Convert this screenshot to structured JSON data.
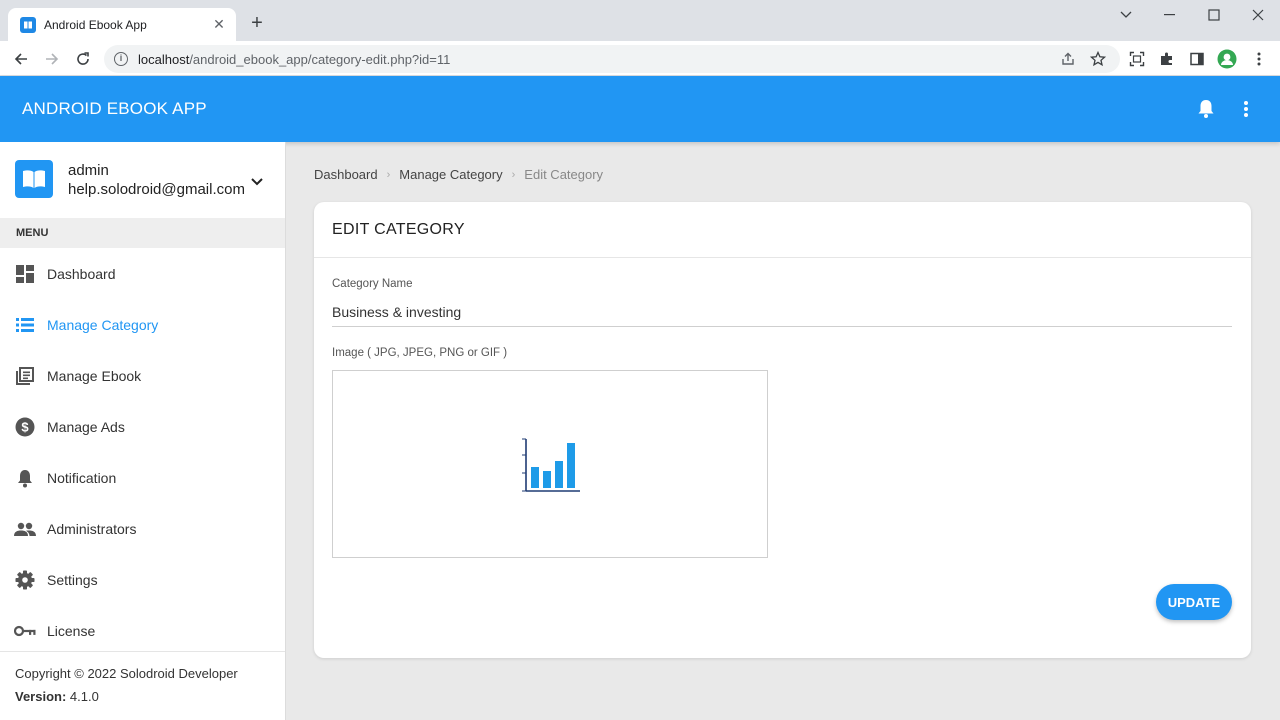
{
  "browser": {
    "tab_title": "Android Ebook App",
    "url_host": "localhost",
    "url_path": "/android_ebook_app/category-edit.php?id=11"
  },
  "app": {
    "title": "ANDROID EBOOK APP",
    "accent_color": "#2196f3"
  },
  "user": {
    "name": "admin",
    "email": "help.solodroid@gmail.com"
  },
  "sidebar": {
    "menu_header": "MENU",
    "items": [
      {
        "label": "Dashboard",
        "icon": "dashboard-icon",
        "active": false
      },
      {
        "label": "Manage Category",
        "icon": "list-icon",
        "active": true
      },
      {
        "label": "Manage Ebook",
        "icon": "library-books-icon",
        "active": false
      },
      {
        "label": "Manage Ads",
        "icon": "dollar-icon",
        "active": false
      },
      {
        "label": "Notification",
        "icon": "bell-icon",
        "active": false
      },
      {
        "label": "Administrators",
        "icon": "people-icon",
        "active": false
      },
      {
        "label": "Settings",
        "icon": "gear-icon",
        "active": false
      },
      {
        "label": "License",
        "icon": "key-icon",
        "active": false
      }
    ],
    "footer": {
      "copyright": "Copyright © 2022 Solodroid Developer",
      "version_label": "Version:",
      "version_value": "4.1.0"
    }
  },
  "breadcrumb": {
    "items": [
      "Dashboard",
      "Manage Category",
      "Edit Category"
    ]
  },
  "form": {
    "title": "EDIT CATEGORY",
    "category_name_label": "Category Name",
    "category_name_value": "Business & investing",
    "image_label": "Image ( JPG, JPEG, PNG or GIF )",
    "image_icon": "bar-chart-icon",
    "submit_label": "UPDATE"
  }
}
